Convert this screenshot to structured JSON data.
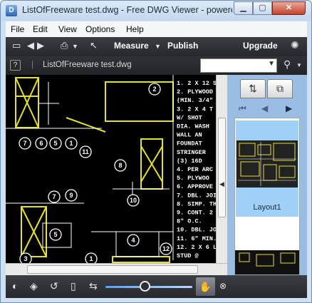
{
  "window": {
    "title": "ListOfFreeware test.dwg - Free DWG Viewer - powere",
    "app_icon": "dwg-icon",
    "controls": {
      "minimize": "▁",
      "maximize": "▢",
      "close": "✕"
    }
  },
  "menubar": {
    "items": [
      "File",
      "Edit",
      "View",
      "Options",
      "Help"
    ]
  },
  "toolbar": {
    "measure": "Measure",
    "publish": "Publish",
    "upgrade": "Upgrade",
    "icons": [
      "folder-icon",
      "back-icon",
      "forward-icon",
      "print-icon",
      "pointer-icon",
      "logo-icon"
    ]
  },
  "addressbar": {
    "help": "?",
    "file_label": "ListOfFreeware test.dwg",
    "search_value": ""
  },
  "drawing": {
    "notes": [
      "1. 2 X 12 S",
      "2. PLYWOOD",
      "   (MIN. 3/4\"",
      "3. 2 X 4 T",
      "   W/ SHOT",
      "   DIA. WASH",
      "   WALL AN",
      "   FOUNDAT",
      "   STRINGER",
      "   (3) 16D",
      "4. PER ARC",
      "5. PLYWOO",
      "6. APPROVE",
      "7. DBL. JOI",
      "8. SIMP. TH",
      "9. CONT. 2",
      "   8\" O.C.",
      "10. DBL. JOIS",
      "11. 6\" MIN. 6",
      "12. 2 X 6 L",
      "    STUD @"
    ],
    "callouts": [
      "7",
      "6",
      "5",
      "1",
      "2",
      "11",
      "8",
      "7",
      "9",
      "5",
      "10",
      "4",
      "3",
      "1",
      "12"
    ]
  },
  "sidepanel": {
    "tabs": [
      "layouts-tab",
      "layers-tab"
    ],
    "nav": [
      "first-icon",
      "prev-icon",
      "next-icon"
    ],
    "thumbnails": [
      {
        "label": "Layout1",
        "selected": true
      }
    ]
  },
  "bottombar": {
    "icons": [
      "contrast-icon",
      "layers-icon",
      "rotate-icon",
      "page-icon",
      "fit-icon",
      "pan-hand-icon"
    ],
    "zoom_level": 0.45
  }
}
